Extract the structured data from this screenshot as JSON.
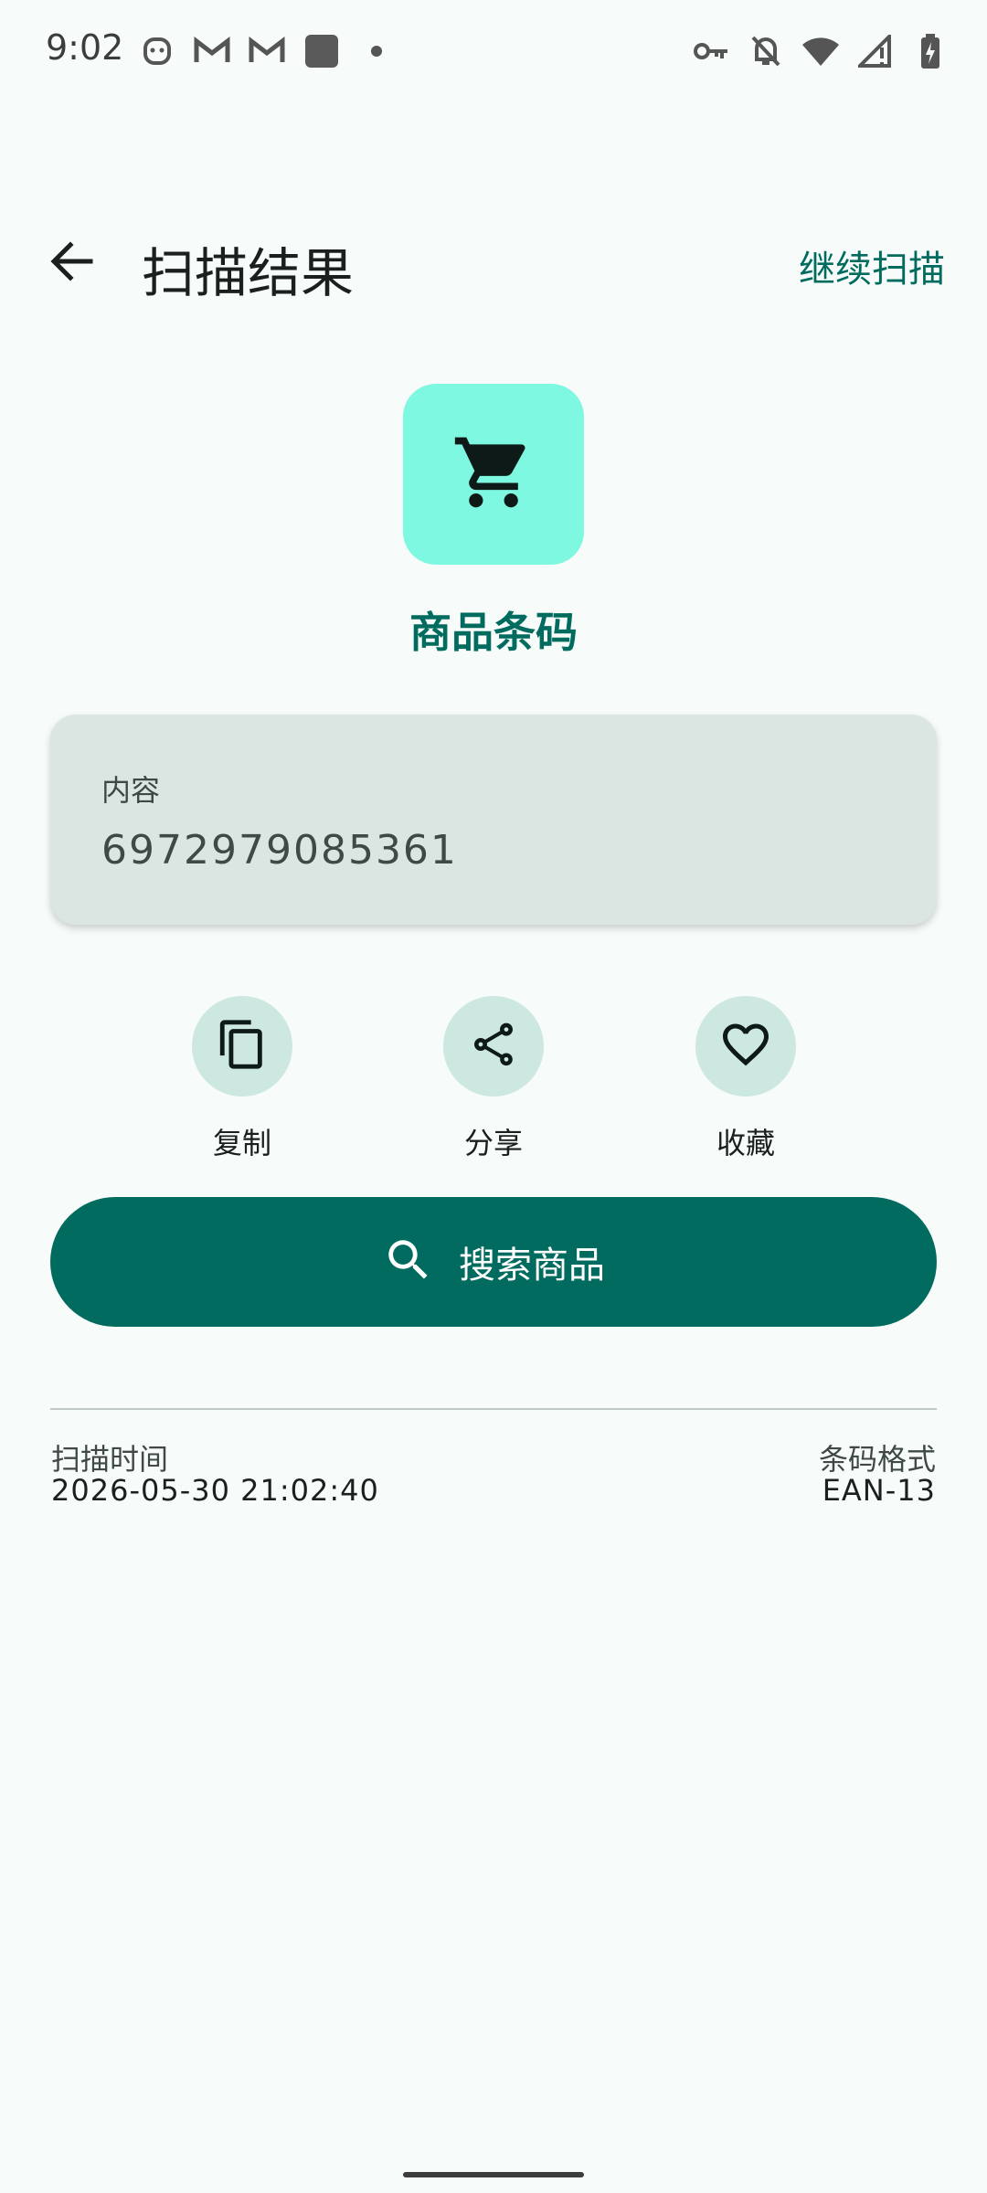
{
  "status_bar": {
    "time": "9:02",
    "left_icons": [
      "android-face-icon",
      "gmail-icon",
      "gmail-icon",
      "app-square-icon",
      "dot-icon"
    ],
    "right_icons": [
      "vpn-key-icon",
      "notifications-off-icon",
      "wifi-icon",
      "signal-icon",
      "battery-charging-icon"
    ]
  },
  "app_bar": {
    "back_icon": "arrow-back-icon",
    "title": "扫描结果",
    "action_label": "继续扫描"
  },
  "result": {
    "type_icon": "shopping-cart-icon",
    "type_label": "商品条码",
    "content_label": "内容",
    "content_value": "6972979085361"
  },
  "actions": [
    {
      "icon": "copy-icon",
      "label": "复制"
    },
    {
      "icon": "share-icon",
      "label": "分享"
    },
    {
      "icon": "favorite-icon",
      "label": "收藏"
    }
  ],
  "search_button": {
    "icon": "search-icon",
    "label": "搜索商品"
  },
  "meta": {
    "scan_time_label": "扫描时间",
    "scan_time_value": "2026-05-30 21:02:40",
    "format_label": "条码格式",
    "format_value": "EAN-13"
  },
  "colors": {
    "accent": "#006b5e",
    "tile_background": "#7ff8e1",
    "card_background": "#dbe5e1",
    "action_circle": "#cde8e1",
    "page_background": "#f7fbf9"
  }
}
